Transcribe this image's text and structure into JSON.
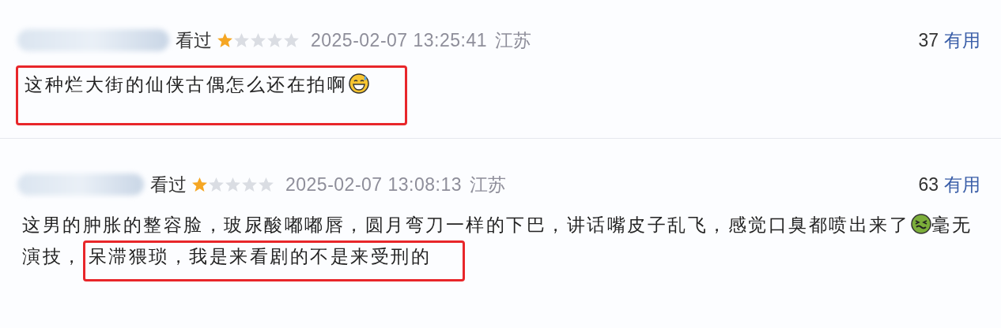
{
  "comments": [
    {
      "status": "看过",
      "stars": 1,
      "time": "2025-02-07 13:25:41",
      "location": "江苏",
      "votes": "37",
      "vote_label": "有用",
      "segments": [
        {
          "kind": "highlight",
          "text": "这种烂大街的仙侠古偶怎么还在拍啊"
        },
        {
          "kind": "grin"
        }
      ]
    },
    {
      "status": "看过",
      "stars": 1,
      "time": "2025-02-07 13:08:13",
      "location": "江苏",
      "votes": "63",
      "vote_label": "有用",
      "segments": [
        {
          "kind": "text",
          "text": "这男的肿胀的整容脸，玻尿酸嘟嘟唇，圆月弯刀一样的下巴，讲话嘴皮子乱飞，感觉口臭都喷出来了"
        },
        {
          "kind": "sick"
        },
        {
          "kind": "text",
          "text": "毫无演技，"
        },
        {
          "kind": "highlight",
          "text": "呆滞猥琐，我是来看剧的不是来受刑的"
        }
      ]
    }
  ]
}
